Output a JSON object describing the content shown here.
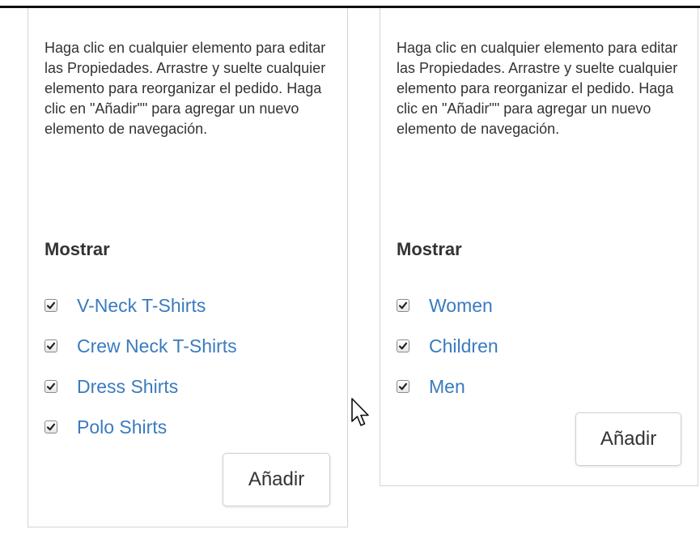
{
  "panels": [
    {
      "description": "Haga clic en cualquier elemento para editar las Propiedades. Arrastre y suelte cualquier elemento para reorganizar el pedido. Haga clic en \"Añadir\"\" para agregar un nuevo elemento de navegación.",
      "section_title": "Mostrar",
      "items": [
        {
          "label": "V-Neck T-Shirts",
          "checked": true
        },
        {
          "label": "Crew Neck T-Shirts",
          "checked": true
        },
        {
          "label": "Dress Shirts",
          "checked": true
        },
        {
          "label": "Polo Shirts",
          "checked": true
        }
      ],
      "add_label": "Añadir"
    },
    {
      "description": "Haga clic en cualquier elemento para editar las Propiedades. Arrastre y suelte cualquier elemento para reorganizar el pedido. Haga clic en \"Añadir\"\" para agregar un nuevo elemento de navegación.",
      "section_title": "Mostrar",
      "items": [
        {
          "label": "Women",
          "checked": true
        },
        {
          "label": "Children",
          "checked": true
        },
        {
          "label": "Men",
          "checked": true
        }
      ],
      "add_label": "Añadir"
    }
  ],
  "colors": {
    "link": "#3a7bbf",
    "text": "#333333",
    "border": "#d4d4d4"
  },
  "icons": {
    "checkbox": "checkmark-icon",
    "cursor": "mouse-pointer-icon"
  }
}
